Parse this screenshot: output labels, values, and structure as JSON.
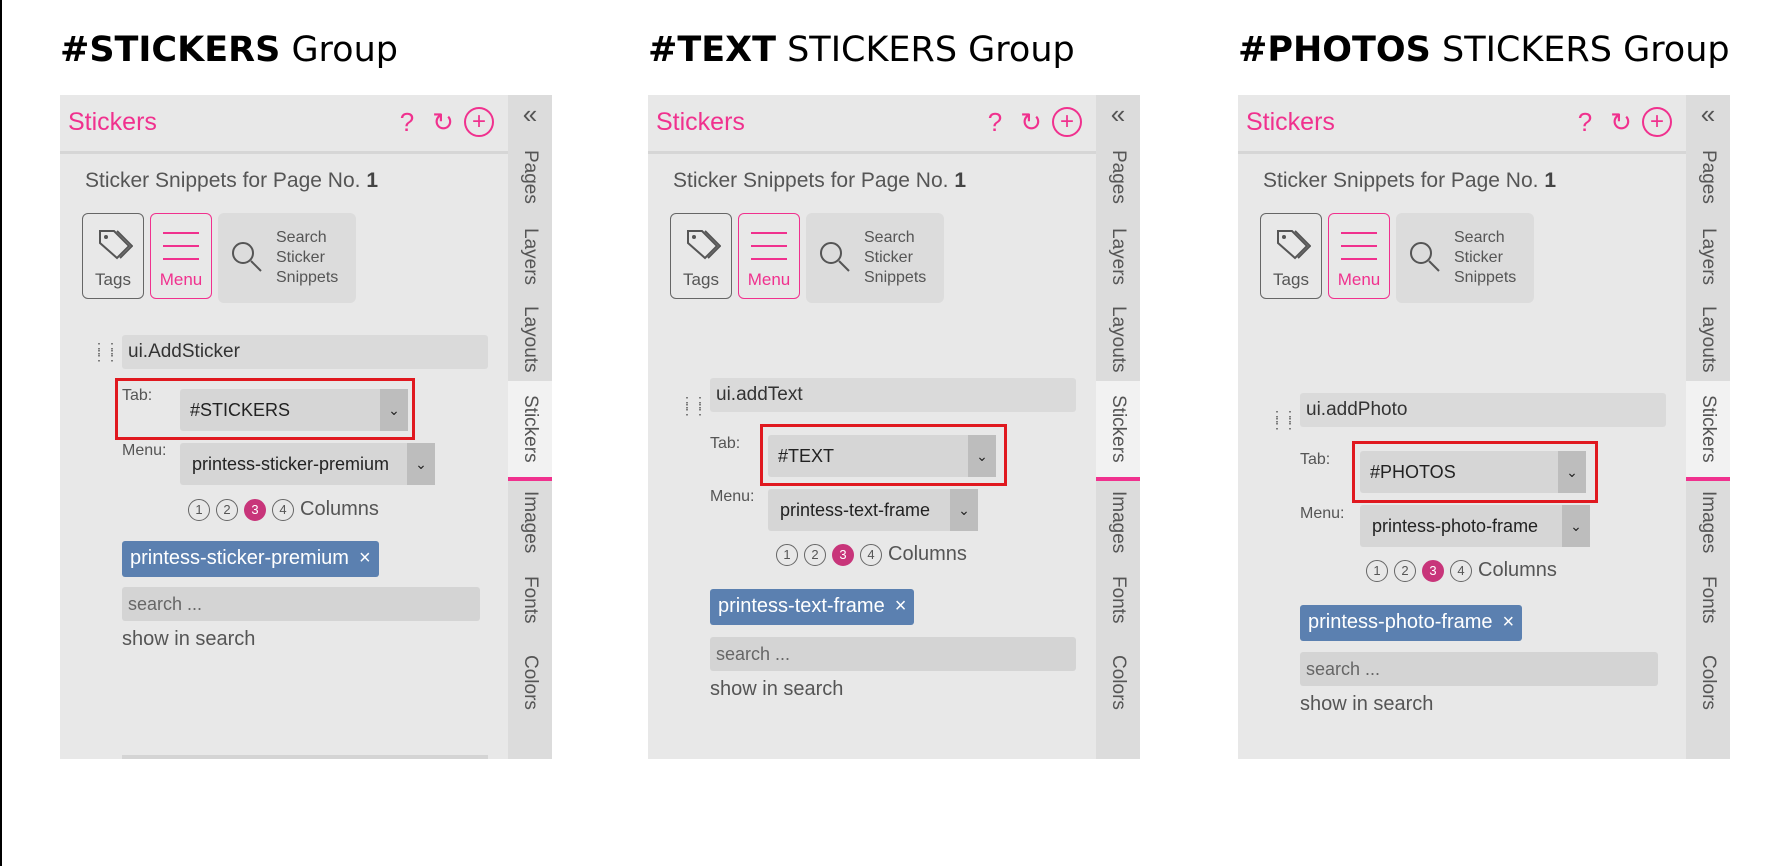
{
  "groups": [
    {
      "title_bold": "#STICKERS",
      "title_rest": " Group",
      "panel_title": "Stickers",
      "subtitle_prefix": "Sticker Snippets for Page No.",
      "page_no": "1",
      "tags_label": "Tags",
      "menu_label": "Menu",
      "search_btn_lines": [
        "Search",
        "Sticker",
        "Snippets"
      ],
      "snippet_name": "ui.AddSticker",
      "tab_label": "Tab:",
      "tab_value": "#STICKERS",
      "menu_field_label": "Menu:",
      "menu_value": "printess-sticker-premium",
      "columns": [
        "1",
        "2",
        "3",
        "4"
      ],
      "columns_selected": 3,
      "columns_label": "Columns",
      "chip": "printess-sticker-premium",
      "chip_close": "×",
      "search_placeholder": "search ...",
      "show_in_search": "show in search"
    },
    {
      "title_bold": "#TEXT",
      "title_rest": " STICKERS Group",
      "panel_title": "Stickers",
      "subtitle_prefix": "Sticker Snippets for Page No.",
      "page_no": "1",
      "tags_label": "Tags",
      "menu_label": "Menu",
      "search_btn_lines": [
        "Search",
        "Sticker",
        "Snippets"
      ],
      "snippet_name": "ui.addText",
      "tab_label": "Tab:",
      "tab_value": "#TEXT",
      "menu_field_label": "Menu:",
      "menu_value": "printess-text-frame",
      "columns": [
        "1",
        "2",
        "3",
        "4"
      ],
      "columns_selected": 3,
      "columns_label": "Columns",
      "chip": "printess-text-frame",
      "chip_close": "×",
      "search_placeholder": "search ...",
      "show_in_search": "show in search"
    },
    {
      "title_bold": "#PHOTOS",
      "title_rest": " STICKERS Group",
      "panel_title": "Stickers",
      "subtitle_prefix": "Sticker Snippets for Page No.",
      "page_no": "1",
      "tags_label": "Tags",
      "menu_label": "Menu",
      "search_btn_lines": [
        "Search",
        "Sticker",
        "Snippets"
      ],
      "snippet_name": "ui.addPhoto",
      "tab_label": "Tab:",
      "tab_value": "#PHOTOS",
      "menu_field_label": "Menu:",
      "menu_value": "printess-photo-frame",
      "columns": [
        "1",
        "2",
        "3",
        "4"
      ],
      "columns_selected": 3,
      "columns_label": "Columns",
      "chip": "printess-photo-frame",
      "chip_close": "×",
      "search_placeholder": "search ...",
      "show_in_search": "show in search"
    }
  ],
  "sidebar": {
    "collapse": "«",
    "tabs": [
      "Pages",
      "Layers",
      "Layouts",
      "Stickers",
      "Images",
      "Fonts",
      "Colors"
    ],
    "active": "Stickers"
  },
  "header_icons": {
    "help": "?",
    "refresh": "↻",
    "add": "+"
  },
  "colors": {
    "accent": "#f0318e",
    "chip": "#5b80b0",
    "highlight": "#e0181f",
    "panel": "#e8e8e8"
  }
}
